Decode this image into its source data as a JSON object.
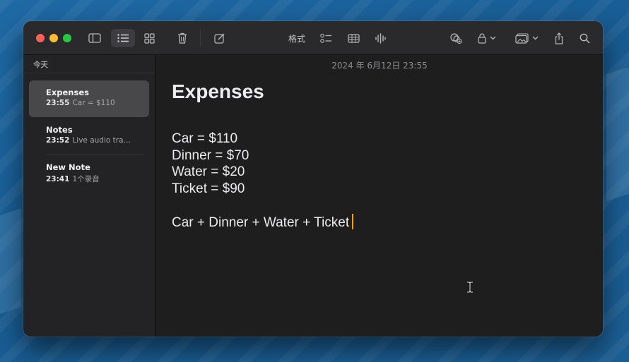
{
  "sidebar": {
    "section_label": "今天",
    "notes": [
      {
        "title": "Expenses",
        "time": "23:55",
        "preview": "Car = $110"
      },
      {
        "title": "Notes",
        "time": "23:52",
        "preview": "Live audio tra…"
      },
      {
        "title": "New Note",
        "time": "23:41",
        "preview": "1个录音"
      }
    ]
  },
  "toolbar": {
    "format_label": "格式",
    "icons": [
      "sidebar-toggle-icon",
      "list-view-icon",
      "gallery-view-icon",
      "trash-icon",
      "compose-icon",
      "checklist-icon",
      "table-icon",
      "audio-waveform-icon",
      "collaborate-icon",
      "lock-icon",
      "media-icon",
      "share-icon",
      "search-icon"
    ]
  },
  "editor": {
    "date": "2024 年 6月12日 23:55",
    "title": "Expenses",
    "lines": [
      "Car = $110",
      "Dinner = $70",
      "Water = $20",
      "Ticket = $90"
    ],
    "formula": "Car + Dinner + Water + Ticket"
  },
  "colors": {
    "accent_caret": "#f0a11d",
    "close": "#fe5f57",
    "minimize": "#febc2e",
    "maximize": "#28c840"
  }
}
